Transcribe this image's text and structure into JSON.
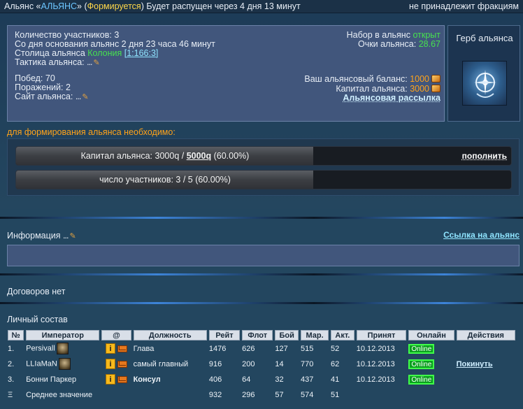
{
  "topbar": {
    "prefix": "Альянс «",
    "alliance_name": "АЛЬЯНС",
    "suffix_1": "» (",
    "status": "Формируется",
    "suffix_2": ") Будет распущен через 4 дня 13 минут",
    "faction": "не принадлежит фракциям"
  },
  "stats": {
    "members_count": "Количество участников: 3",
    "founded": "Со дня основания альянс 2 дня 23 часа 46 минут",
    "capital_label": "Столица альянса ",
    "capital_name": "Колония",
    "capital_coords": "[1:166:3]",
    "tactics_label": "Тактика альянса: ",
    "tactics_value": "...",
    "wins": "Побед: 70",
    "losses": "Поражений: 2",
    "site_label": "Сайт альянса: ",
    "site_value": "...",
    "recruit_label": "Набор в альянс ",
    "recruit_value": "открыт",
    "points_label": "Очки альянса: ",
    "points_value": "28.67",
    "balance_label": "Ваш альянсовый баланс: ",
    "balance_value": "1000",
    "capital_money_label": "Капитал альянса: ",
    "capital_money_value": "3000",
    "mailing": "Альянсовая рассылка"
  },
  "emblem": {
    "title": "Герб альянса"
  },
  "requirements": {
    "title": "для формирования альянса необходимо:",
    "capital": {
      "text_before": "Капитал альянса: 3000q / ",
      "target": "5000q",
      "text_after": " (60.00%)",
      "progress": 0.6,
      "action": "пополнить"
    },
    "members": {
      "text": "число участников: 3 / 5 (60.00%)",
      "progress": 0.6
    }
  },
  "info": {
    "title": "Информация ",
    "title_dots": "...",
    "link": "Ссылка на альянс"
  },
  "treaties": {
    "title": "Договоров нет"
  },
  "roster": {
    "title": "Личный состав",
    "headers": [
      "№",
      "Император",
      "@",
      "Должность",
      "Рейт",
      "Флот",
      "Бой",
      "Мар.",
      "Акт.",
      "Принят",
      "Онлайн",
      "Действия"
    ],
    "rows": [
      {
        "num": "1.",
        "name": "Persivall",
        "role": "Глава",
        "rate": "1476",
        "fleet": "626",
        "battle": "127",
        "mar": "515",
        "act": "52",
        "joined": "10.12.2013",
        "online": "Online",
        "action": ""
      },
      {
        "num": "2.",
        "name": "LLIaMaN",
        "role": "самый главный",
        "rate": "916",
        "fleet": "200",
        "battle": "14",
        "mar": "770",
        "act": "62",
        "joined": "10.12.2013",
        "online": "Online",
        "action": "Покинуть"
      },
      {
        "num": "3.",
        "name": "Бонни Паркер",
        "role": "Консул",
        "rate": "406",
        "fleet": "64",
        "battle": "32",
        "mar": "437",
        "act": "41",
        "joined": "10.12.2013",
        "online": "Online",
        "action": ""
      }
    ],
    "avg": {
      "num": "Ξ",
      "label": "Среднее значение",
      "rate": "932",
      "fleet": "296",
      "battle": "57",
      "mar": "574",
      "act": "51"
    },
    "info_icon": "i"
  },
  "colors": {
    "accent_green": "#47e14f",
    "accent_orange": "#ffa31a",
    "panel": "#41567c",
    "online": "#0aa01e"
  },
  "icons": [
    "pencil-icon",
    "coin-icon",
    "info-icon",
    "mail-icon",
    "avatar"
  ]
}
